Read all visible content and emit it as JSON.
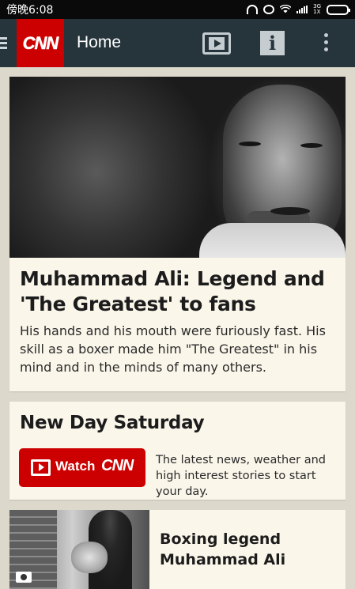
{
  "status_bar": {
    "time": "傍晚6:08",
    "network_label": "3G",
    "network_sub": "1X"
  },
  "app_bar": {
    "logo_text": "CNN",
    "title": "Home",
    "brand_color": "#cc0000",
    "bar_color": "#26343c",
    "icons": [
      "hamburger-menu-icon",
      "video-icon",
      "info-icon",
      "more-options-icon"
    ]
  },
  "hero_story": {
    "headline": "Muhammad Ali: Legend and 'The Greatest' to fans",
    "summary": "His hands and his mouth were furiously fast. His skill as a boxer made him \"The Greatest\" in his mind and in the minds of many others."
  },
  "show_card": {
    "title": "New Day Saturday",
    "watch_label": "Watch",
    "watch_brand": "CNN",
    "description": "The latest news, weather and high interest stories to start your day."
  },
  "story_card": {
    "headline": "Boxing legend Muhammad Ali",
    "media_icon": "camera-icon"
  }
}
